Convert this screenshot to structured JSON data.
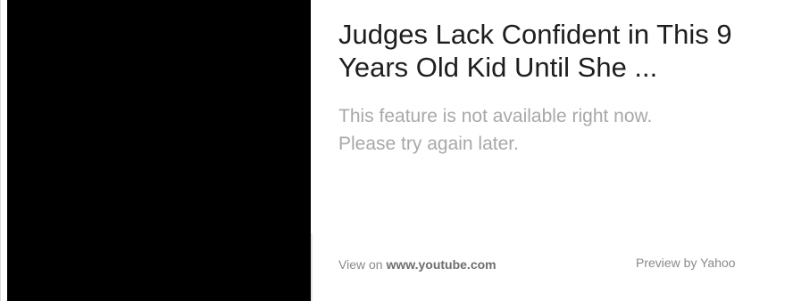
{
  "card": {
    "title": "Judges Lack Confident in This 9 Years Old Kid Until She ...",
    "description": {
      "line1": "This feature is not available right now.",
      "line2": "Please try again later."
    },
    "footer": {
      "view_on_label": "View on",
      "source_domain": "www.youtube.com",
      "preview_label": "Preview by Yahoo"
    },
    "thumbnail_color": "#000000"
  }
}
